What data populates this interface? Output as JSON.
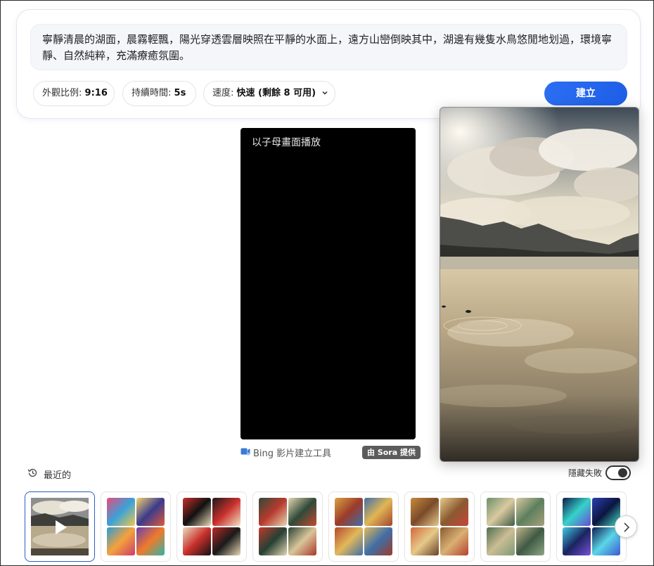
{
  "prompt": {
    "text": "寧靜清晨的湖面，晨霧輕飄，陽光穿透雲層映照在平靜的水面上，遠方山巒倒映其中，湖邊有幾隻水鳥悠閒地划過，環境寧靜、自然純粹，充滿療癒氛圍。"
  },
  "options": {
    "aspect_label": "外觀比例:",
    "aspect_value": "9:16",
    "duration_label": "持續時間:",
    "duration_value": "5s",
    "speed_label": "速度:",
    "speed_value": "快速 (剩餘 8 可用)"
  },
  "create_label": "建立",
  "player": {
    "pip_label": "以子母畫面播放"
  },
  "footer": {
    "bing_label": "Bing 影片建立工具",
    "sora_badge": "由 Sora 提供"
  },
  "recent": {
    "label": "最近的",
    "hide_failed_label": "隱藏失敗",
    "hide_failed_on": true
  },
  "icons": {
    "speed_chevron": "chevron-down-icon",
    "bing_video": "video-icon",
    "history": "history-icon",
    "play": "play-icon",
    "next": "chevron-right-icon"
  },
  "colors": {
    "accent": "#2466ee",
    "badge": "#5c5c5c"
  }
}
